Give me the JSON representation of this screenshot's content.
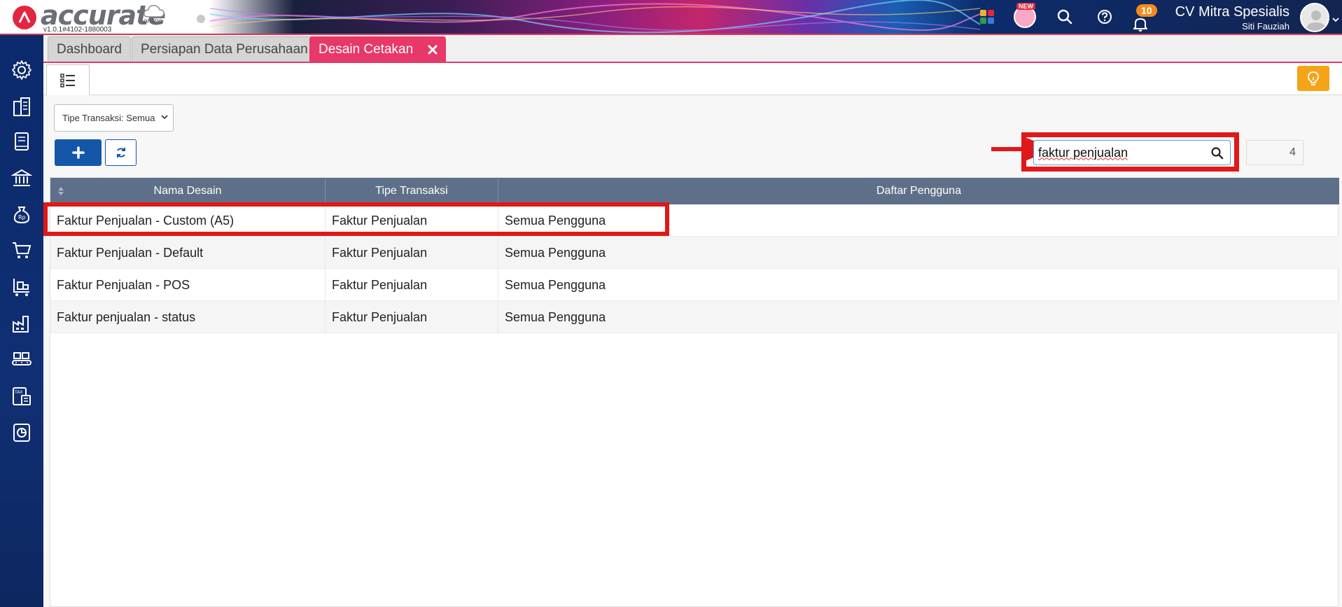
{
  "app": {
    "logo_text": "accurate",
    "logo_sub": "online",
    "version": "v1.0.1#4102-1880003",
    "new_label": "NEW",
    "notification_count": "10",
    "company": "CV Mitra Spesialis",
    "user": "Siti Fauziah"
  },
  "tabs": [
    {
      "label": "Dashboard"
    },
    {
      "label": "Persiapan Data Perusahaan"
    },
    {
      "label": "Desain Cetakan"
    }
  ],
  "tab_count": "3",
  "filter": {
    "label": "Tipe Transaksi: Semua"
  },
  "search": {
    "value": "faktur penjualan"
  },
  "result_count": "4",
  "table": {
    "headers": [
      "Nama Desain",
      "Tipe Transaksi",
      "Daftar Pengguna"
    ],
    "rows": [
      [
        "Faktur Penjualan - Custom (A5)",
        "Faktur Penjualan",
        "Semua Pengguna"
      ],
      [
        "Faktur Penjualan - Default",
        "Faktur Penjualan",
        "Semua Pengguna"
      ],
      [
        "Faktur Penjualan - POS",
        "Faktur Penjualan",
        "Semua Pengguna"
      ],
      [
        "Faktur penjualan - status",
        "Faktur Penjualan",
        "Semua Pengguna"
      ]
    ]
  },
  "sidebar_icons": [
    "gear-icon",
    "building-icon",
    "book-icon",
    "bank-icon",
    "money-bag-icon",
    "cart-icon",
    "trolley-icon",
    "factory-icon",
    "conveyor-icon",
    "tax-icon",
    "report-icon"
  ],
  "colors": {
    "accent_pink": "#e8386a",
    "primary_blue": "#1457a8",
    "table_header": "#5e7089",
    "highlight_red": "#e01818",
    "sidebar": "#0b2a6b",
    "bulb_orange": "#f6a417"
  }
}
